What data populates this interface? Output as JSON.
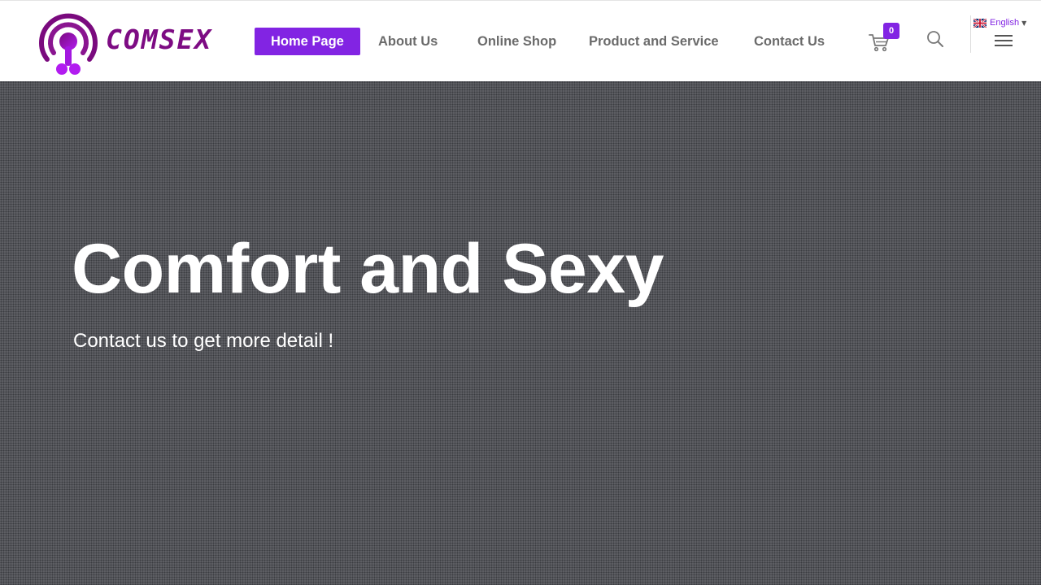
{
  "header": {
    "logo_text": "COMSEX",
    "nav": {
      "home": "Home Page",
      "about": "About Us",
      "shop": "Online Shop",
      "product": "Product and Service",
      "contact": "Contact Us"
    },
    "cart_count": "0",
    "language": "English"
  },
  "hero": {
    "title": "Comfort and Sexy",
    "subtitle": "Contact us to get more detail !"
  },
  "icons": {
    "logo": "logo-icon",
    "cart": "cart-icon",
    "search": "search-icon",
    "flag": "uk-flag-icon",
    "caret": "caret-down-icon",
    "menu": "hamburger-menu-icon"
  },
  "colors": {
    "accent": "#8224e3",
    "logo_purple": "#7d0b83",
    "nav_text": "#6b6b6b",
    "hero_bg": "#5e5f64",
    "hero_text": "#ffffff"
  }
}
